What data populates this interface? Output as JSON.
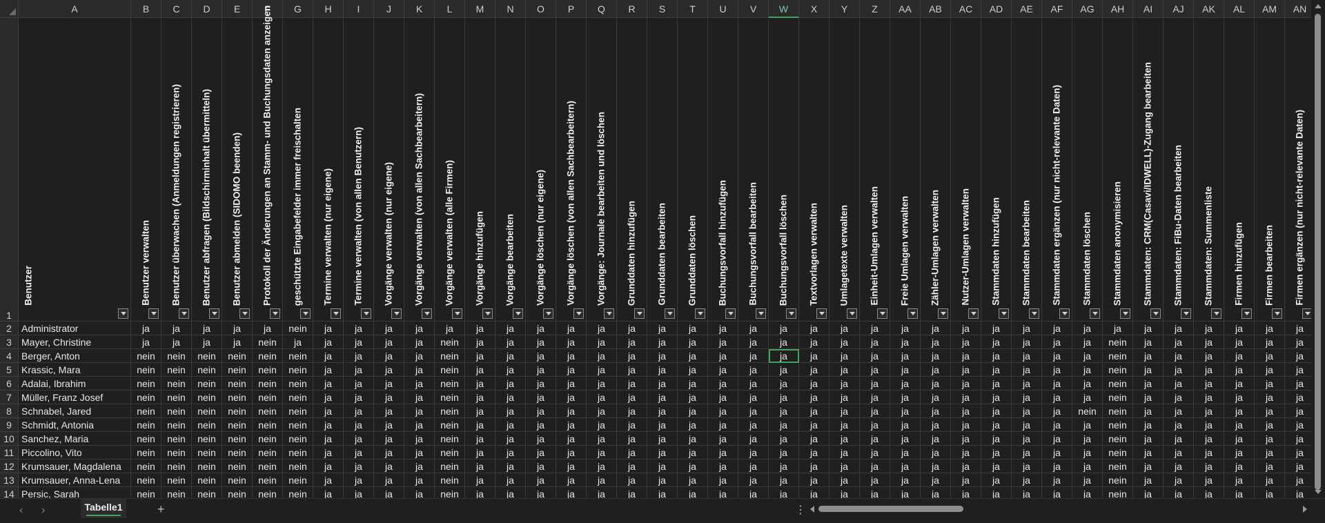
{
  "sheet": {
    "tab_label": "Tabelle1",
    "add_sheet_label": "+",
    "nav_prev": "‹",
    "nav_next": "›",
    "more_label": "⋮"
  },
  "columns": [
    "A",
    "B",
    "C",
    "D",
    "E",
    "F",
    "G",
    "H",
    "I",
    "J",
    "K",
    "L",
    "M",
    "N",
    "O",
    "P",
    "Q",
    "R",
    "S",
    "T",
    "U",
    "V",
    "W",
    "X",
    "Y",
    "Z",
    "AA",
    "AB",
    "AC",
    "AD",
    "AE",
    "AF",
    "AG",
    "AH",
    "AI",
    "AJ",
    "AK",
    "AL",
    "AM",
    "AN"
  ],
  "active_column": "W",
  "header_row_number": "1",
  "headers": [
    "Benutzer",
    "Benutzer verwalten",
    "Benutzer überwachen (Anmeldungen registrieren)",
    "Benutzer abfragen (Bildschirminhalt übermitteln)",
    "Benutzer abmelden (SIDOMO beenden)",
    "Protokoll der Änderungen an Stamm- und Buchungsdaten anzeigen",
    "geschützte Eingabefelder immer freischalten",
    "Termine verwalten (nur eigene)",
    "Termine verwalten (von allen Benutzern)",
    "Vorgänge verwalten (nur eigene)",
    "Vorgänge verwalten (von allen Sachbearbeitern)",
    "Vorgänge verwalten (alle Firmen)",
    "Vorgänge hinzufügen",
    "Vorgänge bearbeiten",
    "Vorgänge löschen (nur eigene)",
    "Vorgänge löschen (von allen Sachbearbeitern)",
    "Vorgänge: Journale bearbeiten und löschen",
    "Grunddaten hinzufügen",
    "Grunddaten bearbeiten",
    "Grunddaten löschen",
    "Buchungsvorfall hinzufügen",
    "Buchungsvorfall bearbeiten",
    "Buchungsvorfall löschen",
    "Textvorlagen verwalten",
    "Umlagetexte verwalten",
    "Einheit-Umlagen verwalten",
    "Freie Umlagen verwalten",
    "Zähler-Umlagen verwalten",
    "Nutzer-Umlagen verwalten",
    "Stammdaten hinzufügen",
    "Stammdaten bearbeiten",
    "Stammdaten ergänzen (nur nicht-relevante Daten)",
    "Stammdaten löschen",
    "Stammdaten anonymisieren",
    "Stammdaten: CRM(Casavi/IDWELL)-Zugang bearbeiten",
    "Stammdaten: FiBu-Daten bearbeiten",
    "Stammdaten: Summenliste",
    "Firmen hinzufügen",
    "Firmen bearbeiten",
    "Firmen ergänzen (nur nicht-relevante Daten)"
  ],
  "rows": [
    {
      "num": "2",
      "name": "Administrator",
      "values": [
        "ja",
        "ja",
        "ja",
        "ja",
        "ja",
        "nein",
        "ja",
        "ja",
        "ja",
        "ja",
        "ja",
        "ja",
        "ja",
        "ja",
        "ja",
        "ja",
        "ja",
        "ja",
        "ja",
        "ja",
        "ja",
        "ja",
        "ja",
        "ja",
        "ja",
        "ja",
        "ja",
        "ja",
        "ja",
        "ja",
        "ja",
        "ja",
        "ja",
        "ja",
        "ja",
        "ja",
        "ja",
        "ja",
        "ja"
      ]
    },
    {
      "num": "3",
      "name": "Mayer, Christine",
      "values": [
        "ja",
        "ja",
        "ja",
        "ja",
        "nein",
        "ja",
        "ja",
        "ja",
        "ja",
        "ja",
        "nein",
        "ja",
        "ja",
        "ja",
        "ja",
        "ja",
        "ja",
        "ja",
        "ja",
        "ja",
        "ja",
        "ja",
        "ja",
        "ja",
        "ja",
        "ja",
        "ja",
        "ja",
        "ja",
        "ja",
        "ja",
        "ja",
        "nein",
        "ja",
        "ja",
        "ja",
        "ja",
        "ja",
        "ja"
      ]
    },
    {
      "num": "4",
      "name": "Berger, Anton",
      "values": [
        "nein",
        "nein",
        "nein",
        "nein",
        "nein",
        "nein",
        "ja",
        "ja",
        "ja",
        "ja",
        "nein",
        "ja",
        "ja",
        "ja",
        "ja",
        "ja",
        "ja",
        "ja",
        "ja",
        "ja",
        "ja",
        "ja",
        "ja",
        "ja",
        "ja",
        "ja",
        "ja",
        "ja",
        "ja",
        "ja",
        "ja",
        "ja",
        "nein",
        "ja",
        "ja",
        "ja",
        "ja",
        "ja",
        "ja"
      ]
    },
    {
      "num": "5",
      "name": "Krassic, Mara",
      "values": [
        "nein",
        "nein",
        "nein",
        "nein",
        "nein",
        "nein",
        "ja",
        "ja",
        "ja",
        "ja",
        "nein",
        "ja",
        "ja",
        "ja",
        "ja",
        "ja",
        "ja",
        "ja",
        "ja",
        "ja",
        "ja",
        "ja",
        "ja",
        "ja",
        "ja",
        "ja",
        "ja",
        "ja",
        "ja",
        "ja",
        "ja",
        "ja",
        "nein",
        "ja",
        "ja",
        "ja",
        "ja",
        "ja",
        "ja"
      ]
    },
    {
      "num": "6",
      "name": "Adalai, Ibrahim",
      "values": [
        "nein",
        "nein",
        "nein",
        "nein",
        "nein",
        "nein",
        "ja",
        "ja",
        "ja",
        "ja",
        "nein",
        "ja",
        "ja",
        "ja",
        "ja",
        "ja",
        "ja",
        "ja",
        "ja",
        "ja",
        "ja",
        "ja",
        "ja",
        "ja",
        "ja",
        "ja",
        "ja",
        "ja",
        "ja",
        "ja",
        "ja",
        "ja",
        "nein",
        "ja",
        "ja",
        "ja",
        "ja",
        "ja",
        "ja"
      ]
    },
    {
      "num": "7",
      "name": "Müller, Franz Josef",
      "values": [
        "nein",
        "nein",
        "nein",
        "nein",
        "nein",
        "nein",
        "ja",
        "ja",
        "ja",
        "ja",
        "nein",
        "ja",
        "ja",
        "ja",
        "ja",
        "ja",
        "ja",
        "ja",
        "ja",
        "ja",
        "ja",
        "ja",
        "ja",
        "ja",
        "ja",
        "ja",
        "ja",
        "ja",
        "ja",
        "ja",
        "ja",
        "ja",
        "nein",
        "ja",
        "ja",
        "ja",
        "ja",
        "ja",
        "ja"
      ]
    },
    {
      "num": "8",
      "name": "Schnabel, Jared",
      "values": [
        "nein",
        "nein",
        "nein",
        "nein",
        "nein",
        "nein",
        "ja",
        "ja",
        "ja",
        "ja",
        "nein",
        "ja",
        "ja",
        "ja",
        "ja",
        "ja",
        "ja",
        "ja",
        "ja",
        "ja",
        "ja",
        "ja",
        "ja",
        "ja",
        "ja",
        "ja",
        "ja",
        "ja",
        "ja",
        "ja",
        "ja",
        "nein",
        "nein",
        "ja",
        "ja",
        "ja",
        "ja",
        "ja",
        "ja"
      ]
    },
    {
      "num": "9",
      "name": "Schmidt, Antonia",
      "values": [
        "nein",
        "nein",
        "nein",
        "nein",
        "nein",
        "nein",
        "ja",
        "ja",
        "ja",
        "ja",
        "nein",
        "ja",
        "ja",
        "ja",
        "ja",
        "ja",
        "ja",
        "ja",
        "ja",
        "ja",
        "ja",
        "ja",
        "ja",
        "ja",
        "ja",
        "ja",
        "ja",
        "ja",
        "ja",
        "ja",
        "ja",
        "ja",
        "nein",
        "ja",
        "ja",
        "ja",
        "ja",
        "ja",
        "ja"
      ]
    },
    {
      "num": "10",
      "name": "Sanchez, Maria",
      "values": [
        "nein",
        "nein",
        "nein",
        "nein",
        "nein",
        "nein",
        "ja",
        "ja",
        "ja",
        "ja",
        "nein",
        "ja",
        "ja",
        "ja",
        "ja",
        "ja",
        "ja",
        "ja",
        "ja",
        "ja",
        "ja",
        "ja",
        "ja",
        "ja",
        "ja",
        "ja",
        "ja",
        "ja",
        "ja",
        "ja",
        "ja",
        "ja",
        "nein",
        "ja",
        "ja",
        "ja",
        "ja",
        "ja",
        "ja"
      ]
    },
    {
      "num": "11",
      "name": "Piccolino, Vito",
      "values": [
        "nein",
        "nein",
        "nein",
        "nein",
        "nein",
        "nein",
        "ja",
        "ja",
        "ja",
        "ja",
        "nein",
        "ja",
        "ja",
        "ja",
        "ja",
        "ja",
        "ja",
        "ja",
        "ja",
        "ja",
        "ja",
        "ja",
        "ja",
        "ja",
        "ja",
        "ja",
        "ja",
        "ja",
        "ja",
        "ja",
        "ja",
        "ja",
        "nein",
        "ja",
        "ja",
        "ja",
        "ja",
        "ja",
        "ja"
      ]
    },
    {
      "num": "12",
      "name": "Krumsauer, Magdalena",
      "values": [
        "nein",
        "nein",
        "nein",
        "nein",
        "nein",
        "nein",
        "ja",
        "ja",
        "ja",
        "ja",
        "nein",
        "ja",
        "ja",
        "ja",
        "ja",
        "ja",
        "ja",
        "ja",
        "ja",
        "ja",
        "ja",
        "ja",
        "ja",
        "ja",
        "ja",
        "ja",
        "ja",
        "ja",
        "ja",
        "ja",
        "ja",
        "ja",
        "nein",
        "ja",
        "ja",
        "ja",
        "ja",
        "ja",
        "ja"
      ]
    },
    {
      "num": "13",
      "name": "Krumsauer, Anna-Lena",
      "values": [
        "nein",
        "nein",
        "nein",
        "nein",
        "nein",
        "nein",
        "ja",
        "ja",
        "ja",
        "ja",
        "nein",
        "ja",
        "ja",
        "ja",
        "ja",
        "ja",
        "ja",
        "ja",
        "ja",
        "ja",
        "ja",
        "ja",
        "ja",
        "ja",
        "ja",
        "ja",
        "ja",
        "ja",
        "ja",
        "ja",
        "ja",
        "ja",
        "nein",
        "ja",
        "ja",
        "ja",
        "ja",
        "ja",
        "ja"
      ]
    },
    {
      "num": "14",
      "name": "Persic, Sarah",
      "values": [
        "nein",
        "nein",
        "nein",
        "nein",
        "nein",
        "nein",
        "ja",
        "ja",
        "ja",
        "ja",
        "nein",
        "ja",
        "ja",
        "ja",
        "ja",
        "ja",
        "ja",
        "ja",
        "ja",
        "ja",
        "ja",
        "ja",
        "ja",
        "ja",
        "ja",
        "ja",
        "ja",
        "ja",
        "ja",
        "ja",
        "ja",
        "ja",
        "nein",
        "ja",
        "ja",
        "ja",
        "ja",
        "ja",
        "ja"
      ]
    }
  ],
  "selected_cell": {
    "row": "4",
    "column": "W"
  }
}
